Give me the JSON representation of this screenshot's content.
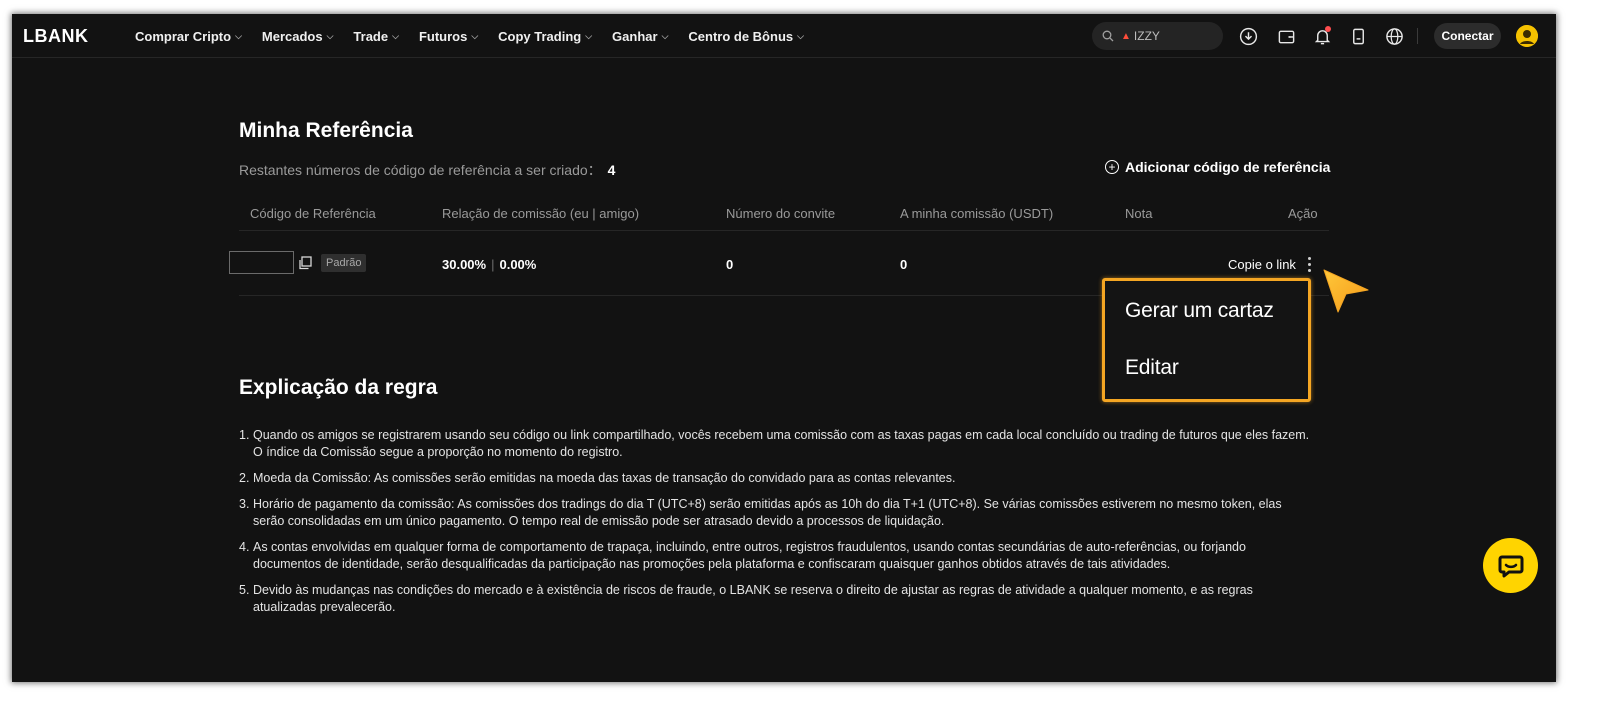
{
  "brand": {
    "logo_text": "LBANK"
  },
  "nav": {
    "items": [
      {
        "label": "Comprar Cripto"
      },
      {
        "label": "Mercados"
      },
      {
        "label": "Trade"
      },
      {
        "label": "Futuros"
      },
      {
        "label": "Copy Trading"
      },
      {
        "label": "Ganhar"
      },
      {
        "label": "Centro de Bônus"
      }
    ],
    "search_placeholder": "IZZY",
    "connect_label": "Conectar",
    "icons": [
      "download-icon",
      "wallet-icon",
      "bell-icon",
      "mobile-app-icon",
      "globe-icon"
    ]
  },
  "referral": {
    "title": "Minha Referência",
    "remaining_label": "Restantes números de código de referência a ser criado：",
    "remaining_count": "4",
    "add_code_label": "Adicionar código de referência",
    "table": {
      "headers": [
        "Código de Referência",
        "Relação de comissão (eu | amigo)",
        "Número do convite",
        "A minha comissão (USDT)",
        "Nota",
        "Ação"
      ],
      "rows": [
        {
          "code": "",
          "badge": "Padrão",
          "ratio_me": "30.00%",
          "ratio_sep": "|",
          "ratio_friend": "0.00%",
          "invites": "0",
          "commission": "0",
          "note": "",
          "action": "Copie o link"
        }
      ]
    },
    "dropdown": {
      "items": [
        "Gerar um cartaz",
        "Editar"
      ],
      "highlight_color": "#f5a623"
    }
  },
  "rules": {
    "title": "Explicação da regra",
    "items": [
      {
        "num": "1.",
        "text": "Quando os amigos se registrarem usando seu código ou link compartilhado, vocês recebem uma comissão com as taxas pagas em cada local concluído ou trading de futuros que eles fazem. O índice da Comissão segue a proporção no momento do registro."
      },
      {
        "num": "2.",
        "text": "Moeda da Comissão: As comissões serão emitidas na moeda das taxas de transação do convidado para as contas relevantes."
      },
      {
        "num": "3.",
        "text": "Horário de pagamento da comissão: As comissões dos tradings do dia T (UTC+8) serão emitidas após as 10h do dia T+1 (UTC+8). Se várias comissões estiverem no mesmo token, elas serão consolidadas em um único pagamento. O tempo real de emissão pode ser atrasado devido a processos de liquidação."
      },
      {
        "num": "4.",
        "text": "As contas envolvidas em qualquer forma de comportamento de trapaça, incluindo, entre outros, registros fraudulentos, usando contas secundárias de auto-referências, ou forjando documentos de identidade, serão desqualificadas da participação nas promoções pela plataforma e confiscaram quaisquer ganhos obtidos através de tais atividades."
      },
      {
        "num": "5.",
        "text": "Devido às mudanças nas condições do mercado e à existência de riscos de fraude, o LBANK se reserva o direito de ajustar as regras de atividade a qualquer momento, e as regras atualizadas prevalecerão."
      }
    ]
  },
  "theme": {
    "background": "#121212",
    "accent": "#ffd400",
    "annotation": "#f5a623"
  }
}
